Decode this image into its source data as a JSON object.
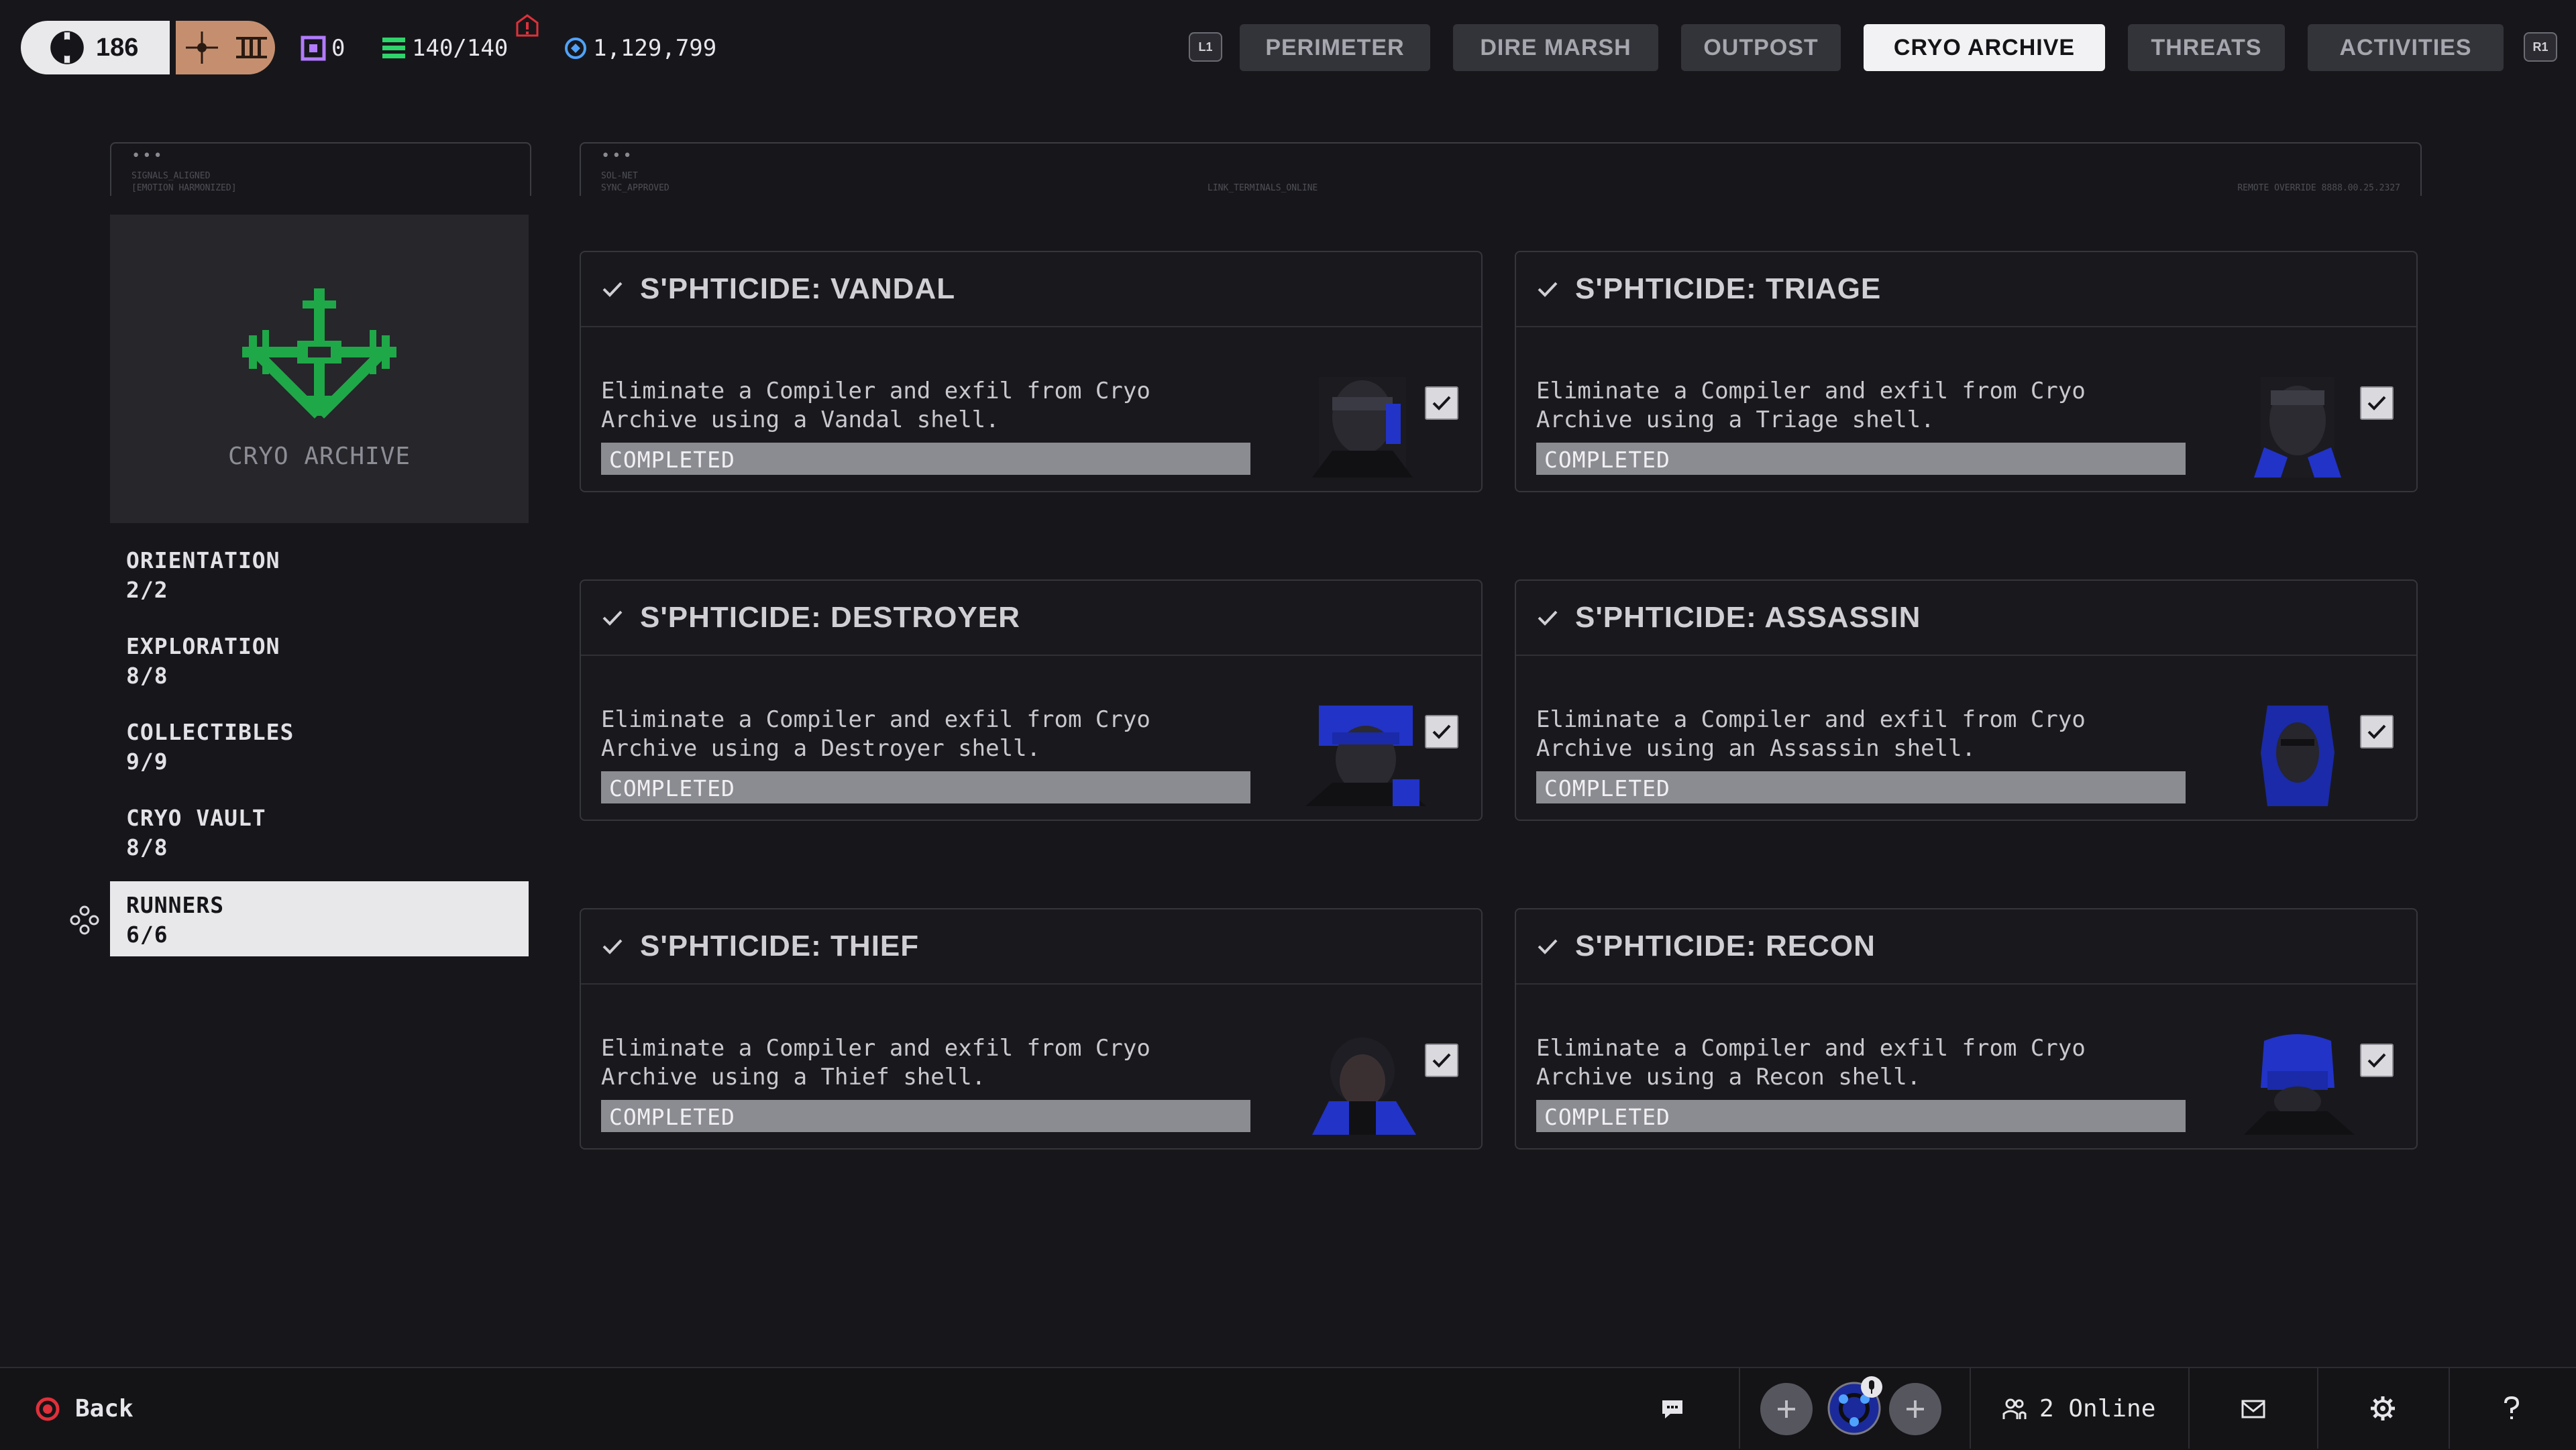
{
  "top_bar": {
    "level": "186",
    "currencies": [
      {
        "icon": "square-token-icon",
        "value": "0"
      },
      {
        "icon": "stack-icon",
        "value": "140/140"
      },
      {
        "icon": "credits-icon",
        "value": "1,129,799"
      }
    ],
    "left_bumper": "L1",
    "right_bumper": "R1",
    "tabs": [
      "PERIMETER",
      "DIRE MARSH",
      "OUTPOST",
      "CRYO ARCHIVE",
      "THREATS",
      "ACTIVITIES"
    ],
    "active_tab": "CRYO ARCHIVE"
  },
  "header_left": {
    "dots": "•••",
    "line1": "SIGNALS_ALIGNED",
    "line2": "[EMOTION HARMONIZED]"
  },
  "header_right": {
    "dots": "•••",
    "line1": "SOL-NET",
    "line2": "SYNC_APPROVED",
    "center": "LINK_TERMINALS_ONLINE",
    "right": "REMOTE OVERRIDE 8888.00.25.2327"
  },
  "map": {
    "name": "CRYO ARCHIVE",
    "accent": "#1fa847"
  },
  "categories": [
    {
      "name": "ORIENTATION",
      "value": "2/2"
    },
    {
      "name": "EXPLORATION",
      "value": "8/8"
    },
    {
      "name": "COLLECTIBLES",
      "value": "9/9"
    },
    {
      "name": "CRYO VAULT",
      "value": "8/8"
    },
    {
      "name": "RUNNERS",
      "value": "6/6"
    }
  ],
  "selected_category": "RUNNERS",
  "cards": [
    {
      "title": "S'PHTICIDE: VANDAL",
      "line1": "Eliminate a Compiler and exfil from Cryo",
      "line2": "Archive using a Vandal shell.",
      "status": "COMPLETED"
    },
    {
      "title": "S'PHTICIDE: TRIAGE",
      "line1": "Eliminate a Compiler and exfil from Cryo",
      "line2": "Archive using a Triage shell.",
      "status": "COMPLETED"
    },
    {
      "title": "S'PHTICIDE: DESTROYER",
      "line1": "Eliminate a Compiler and exfil from Cryo",
      "line2": "Archive using a Destroyer shell.",
      "status": "COMPLETED"
    },
    {
      "title": "S'PHTICIDE: ASSASSIN",
      "line1": "Eliminate a Compiler and exfil from Cryo",
      "line2": "Archive using an Assassin shell.",
      "status": "COMPLETED"
    },
    {
      "title": "S'PHTICIDE: THIEF",
      "line1": "Eliminate a Compiler and exfil from Cryo",
      "line2": "Archive using a Thief shell.",
      "status": "COMPLETED"
    },
    {
      "title": "S'PHTICIDE: RECON",
      "line1": "Eliminate a Compiler and exfil from Cryo",
      "line2": "Archive using a Recon shell.",
      "status": "COMPLETED"
    }
  ],
  "bottom_bar": {
    "back_label": "Back",
    "online_label": "2 Online",
    "icons": [
      "chat-icon",
      "party-slot-icon",
      "player-avatar-icon",
      "party-slot-icon",
      "friends-icon",
      "mail-icon",
      "settings-gear-icon",
      "help-icon"
    ]
  },
  "colors": {
    "background": "#17171b",
    "active_tab": "#f2f2f4",
    "progress_fill": "#8b8b92",
    "brand_green": "#1fa847",
    "runner_blue": "#2233c8",
    "alert_red": "#e0303a"
  }
}
